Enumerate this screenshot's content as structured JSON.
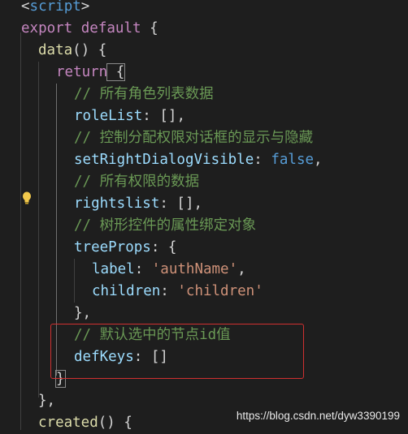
{
  "editor": {
    "lines": [
      {
        "id": "script-tag",
        "tokens": [
          [
            "punc",
            "<"
          ],
          [
            "kw",
            "script"
          ],
          [
            "punc",
            ">"
          ]
        ]
      },
      {
        "id": "export-default",
        "tokens": [
          [
            "ctrl",
            "export"
          ],
          [
            "punc",
            " "
          ],
          [
            "ctrl",
            "default"
          ],
          [
            "punc",
            " {"
          ]
        ]
      },
      {
        "id": "data-fn",
        "tokens": [
          [
            "fn",
            "data"
          ],
          [
            "punc",
            "() {"
          ]
        ]
      },
      {
        "id": "return",
        "tokens": [
          [
            "ctrl",
            "return"
          ],
          [
            "punc",
            " {"
          ]
        ]
      },
      {
        "id": "comment-rolelist",
        "tokens": [
          [
            "cmt",
            "// 所有角色列表数据"
          ]
        ]
      },
      {
        "id": "rolelist",
        "tokens": [
          [
            "prop",
            "roleList"
          ],
          [
            "punc",
            ": [],"
          ]
        ]
      },
      {
        "id": "comment-dialog",
        "tokens": [
          [
            "cmt",
            "// 控制分配权限对话框的显示与隐藏"
          ]
        ]
      },
      {
        "id": "setrightdialog",
        "tokens": [
          [
            "prop",
            "setRightDialogVisible"
          ],
          [
            "punc",
            ": "
          ],
          [
            "kw",
            "false"
          ],
          [
            "punc",
            ","
          ]
        ]
      },
      {
        "id": "comment-rights",
        "tokens": [
          [
            "cmt",
            "// 所有权限的数据"
          ]
        ]
      },
      {
        "id": "rightslist",
        "tokens": [
          [
            "prop",
            "rightslist"
          ],
          [
            "punc",
            ": [],"
          ]
        ]
      },
      {
        "id": "comment-treeprops",
        "tokens": [
          [
            "cmt",
            "// 树形控件的属性绑定对象"
          ]
        ]
      },
      {
        "id": "treeprops",
        "tokens": [
          [
            "prop",
            "treeProps"
          ],
          [
            "punc",
            ": {"
          ]
        ]
      },
      {
        "id": "label",
        "tokens": [
          [
            "prop",
            "label"
          ],
          [
            "punc",
            ": "
          ],
          [
            "str",
            "'authName'"
          ],
          [
            "punc",
            ","
          ]
        ]
      },
      {
        "id": "children",
        "tokens": [
          [
            "prop",
            "children"
          ],
          [
            "punc",
            ": "
          ],
          [
            "str",
            "'children'"
          ]
        ]
      },
      {
        "id": "treeprops-close",
        "tokens": [
          [
            "punc",
            "},"
          ]
        ]
      },
      {
        "id": "comment-defkeys",
        "tokens": [
          [
            "cmt",
            "// 默认选中的节点id值"
          ]
        ]
      },
      {
        "id": "defkeys",
        "tokens": [
          [
            "prop",
            "defKeys"
          ],
          [
            "punc",
            ": []"
          ]
        ]
      },
      {
        "id": "return-close",
        "tokens": [
          [
            "punc",
            "}"
          ]
        ]
      },
      {
        "id": "data-close",
        "tokens": [
          [
            "punc",
            "},"
          ]
        ]
      },
      {
        "id": "created-fn",
        "tokens": [
          [
            "fn",
            "created"
          ],
          [
            "punc",
            "() {"
          ]
        ]
      }
    ]
  },
  "watermark": "https://blog.csdn.net/dyw3390199"
}
